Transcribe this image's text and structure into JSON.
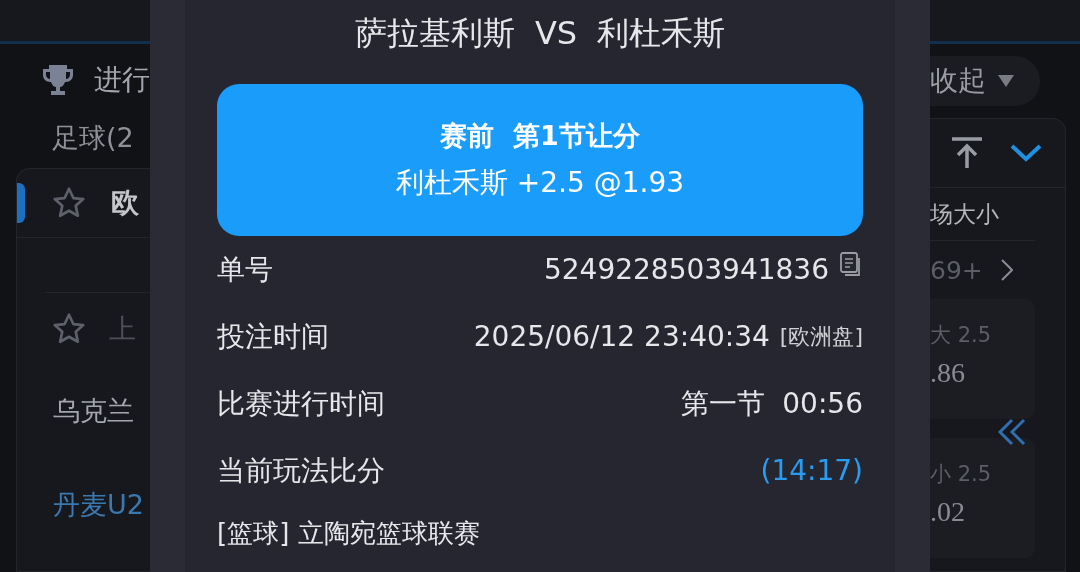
{
  "background": {
    "left": {
      "section_title": "进行",
      "category": "足球(2",
      "league": "欧",
      "match_status": "上",
      "team": "乌克兰",
      "team_link": "丹麦U2"
    },
    "right": {
      "collapse": "收起",
      "market": "场大小",
      "more": "69+",
      "odds": [
        {
          "label": "大 2.5",
          "value": ".86"
        },
        {
          "label": "小 2.5",
          "value": ".02"
        }
      ]
    }
  },
  "modal": {
    "title": "萨拉基利斯  VS  利杜禾斯",
    "bet": {
      "market": "赛前  第1节让分",
      "selection": "利杜禾斯 +2.5 @1.93"
    },
    "rows": [
      {
        "label": "单号",
        "value": "5249228503941836",
        "kind": "copy"
      },
      {
        "label": "投注时间",
        "value": "2025/06/12 23:40:34",
        "tag": "[欧洲盘]",
        "kind": "time"
      },
      {
        "label": "比赛进行时间",
        "value": "第一节  00:56",
        "kind": "plain"
      },
      {
        "label": "当前玩法比分",
        "value": "(14:17)",
        "kind": "score"
      }
    ],
    "league": "[篮球] 立陶宛篮球联赛"
  }
}
